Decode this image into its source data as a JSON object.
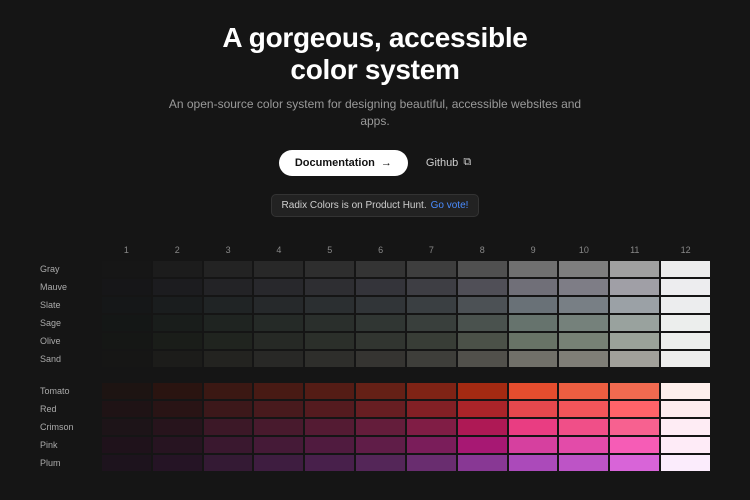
{
  "hero": {
    "title_line1": "A gorgeous, accessible",
    "title_line2": "color system",
    "subtitle": "An open-source color system for designing beautiful, accessible websites and apps.",
    "primary_button": "Documentation",
    "secondary_button": "Github",
    "banner_text": "Radix Colors is on Product Hunt.",
    "banner_link": "Go vote!"
  },
  "columns": [
    "1",
    "2",
    "3",
    "4",
    "5",
    "6",
    "7",
    "8",
    "9",
    "10",
    "11",
    "12"
  ],
  "groups": [
    {
      "rows": [
        {
          "label": "Gray",
          "colors": [
            "#161616",
            "#1c1c1c",
            "#232323",
            "#282828",
            "#2e2e2e",
            "#343434",
            "#3e3e3e",
            "#505050",
            "#707070",
            "#7e7e7e",
            "#a0a0a0",
            "#ededed"
          ]
        },
        {
          "label": "Mauve",
          "colors": [
            "#161618",
            "#1c1c1f",
            "#232326",
            "#28282c",
            "#2e2e32",
            "#34343a",
            "#3e3e44",
            "#504f57",
            "#706f78",
            "#7e7d86",
            "#a09fa6",
            "#ededef"
          ]
        },
        {
          "label": "Slate",
          "colors": [
            "#151718",
            "#1a1d1e",
            "#202425",
            "#26292b",
            "#2b2f31",
            "#313538",
            "#3a3f42",
            "#4c5155",
            "#697177",
            "#787f85",
            "#9ba1a6",
            "#ecedee"
          ]
        },
        {
          "label": "Sage",
          "colors": [
            "#141716",
            "#191d1b",
            "#1f2421",
            "#252a27",
            "#2a2f2c",
            "#303633",
            "#393f3c",
            "#4a524e",
            "#66736d",
            "#75817b",
            "#99a29e",
            "#eceeed"
          ]
        },
        {
          "label": "Olive",
          "colors": [
            "#151715",
            "#1a1d19",
            "#20241f",
            "#262925",
            "#2b2f2a",
            "#313530",
            "#383d36",
            "#4b5148",
            "#687366",
            "#778175",
            "#9aa299",
            "#eceeec"
          ]
        },
        {
          "label": "Sand",
          "colors": [
            "#161615",
            "#1c1c1a",
            "#232320",
            "#282826",
            "#2e2e2b",
            "#353431",
            "#3e3e3a",
            "#51504b",
            "#717069",
            "#7f7e77",
            "#a1a09a",
            "#ededec"
          ]
        }
      ]
    },
    {
      "rows": [
        {
          "label": "Tomato",
          "colors": [
            "#1d1412",
            "#2a1410",
            "#3b1813",
            "#481a14",
            "#541c15",
            "#652016",
            "#7f2315",
            "#a42a12",
            "#e54d2e",
            "#ec5e41",
            "#f16a50",
            "#feefec"
          ]
        },
        {
          "label": "Red",
          "colors": [
            "#1f1315",
            "#291415",
            "#3c181a",
            "#481a1d",
            "#541b1f",
            "#671e22",
            "#822025",
            "#aa2429",
            "#e5484d",
            "#f2555a",
            "#ff6369",
            "#feecee"
          ]
        },
        {
          "label": "Crimson",
          "colors": [
            "#1d1418",
            "#27141c",
            "#3c1827",
            "#481a2d",
            "#541b33",
            "#641d3b",
            "#801d45",
            "#ae1955",
            "#e93d82",
            "#f04f88",
            "#f76190",
            "#feecf4"
          ]
        },
        {
          "label": "Pink",
          "colors": [
            "#1f121b",
            "#271421",
            "#3a182f",
            "#451a37",
            "#501b3f",
            "#601d48",
            "#7a1d5a",
            "#a71873",
            "#d6409f",
            "#e34ba9",
            "#f65cb6",
            "#feebf7"
          ]
        },
        {
          "label": "Plum",
          "colors": [
            "#1d131d",
            "#251425",
            "#341a34",
            "#3e1d40",
            "#48204b",
            "#542658",
            "#692d6f",
            "#883894",
            "#ab4aba",
            "#bd54c6",
            "#d864d8",
            "#fbecfc"
          ]
        }
      ]
    }
  ]
}
